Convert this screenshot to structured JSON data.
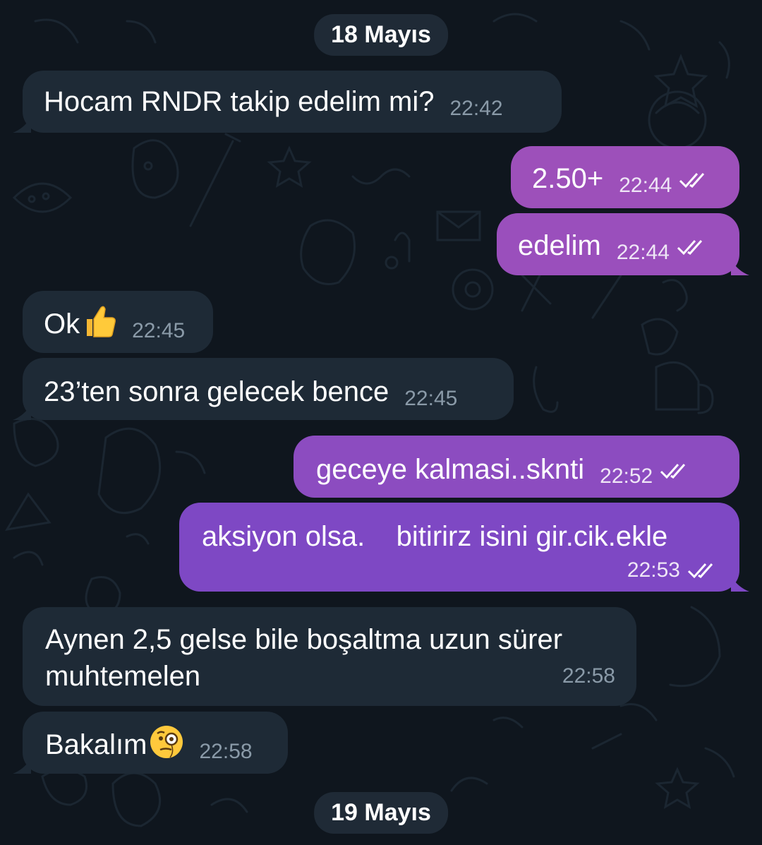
{
  "chat": {
    "date_separators": [
      "18 Mayıs",
      "19 Mayıs"
    ],
    "messages": [
      {
        "direction": "incoming",
        "text": "Hocam RNDR takip edelim mi?",
        "time": "22:42"
      },
      {
        "direction": "outgoing",
        "text": "2.50+",
        "time": "22:44",
        "status": "read"
      },
      {
        "direction": "outgoing",
        "text": "edelim",
        "time": "22:44",
        "status": "read"
      },
      {
        "direction": "incoming",
        "text": "Ok",
        "emoji": "thumbs-up",
        "time": "22:45"
      },
      {
        "direction": "incoming",
        "text": "23’ten sonra gelecek bence",
        "time": "22:45"
      },
      {
        "direction": "outgoing",
        "text": "geceye kalmasi..sknti",
        "time": "22:52",
        "status": "read"
      },
      {
        "direction": "outgoing",
        "text": "aksiyon olsa.    bitirirz isini gir.cik.ekle",
        "time": "22:53",
        "status": "read"
      },
      {
        "direction": "incoming",
        "text_lines": [
          "Aynen 2,5 gelse bile boşaltma uzun sürer",
          "muhtemelen"
        ],
        "time": "22:58"
      },
      {
        "direction": "incoming",
        "text": "Bakalım",
        "emoji": "face-with-monocle",
        "time": "22:58"
      }
    ]
  },
  "colors": {
    "background": "#0f161e",
    "incoming_bubble": "#1e2a36",
    "outgoing_bubble_top": "#9b4fb8",
    "outgoing_bubble_bottom": "#7e48c4",
    "date_pill": "#1f2a36",
    "doodle": "#1b2632"
  }
}
